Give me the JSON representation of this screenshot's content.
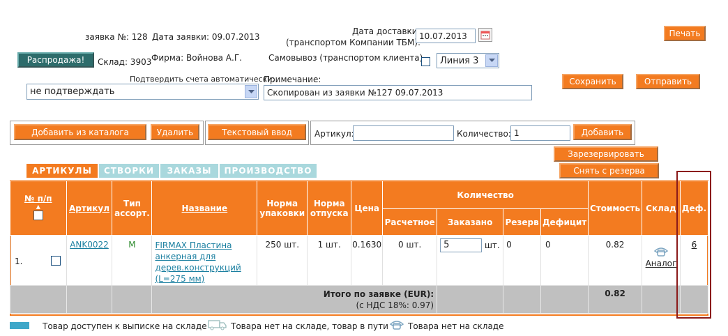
{
  "header": {
    "order_label": "заявка №: 128",
    "date_label": "Дата заявки:  09.07.2013",
    "delivery_label_1": "Дата доставки",
    "delivery_label_2": "(транспортом Компании ТБМ):",
    "delivery_date": "10.07.2013",
    "print_button": "Печать",
    "sale_button": "Распродажа!",
    "warehouse": "Склад: 3903",
    "firm": "Фирма: Войнова А.Г.",
    "pickup": "Самовывоз (транспортом клиента)",
    "line_select": "Линия 3",
    "auto_confirm_label": "Подтвердить счета автоматически:",
    "auto_confirm_value": "не подтверждать",
    "note_label": "Примечание:",
    "note_value": "Скопирован из заявки №127 09.07.2013",
    "save_button": "Сохранить",
    "send_button": "Отправить"
  },
  "toolbar": {
    "add_catalog": "Добавить из каталога",
    "delete": "Удалить",
    "text_input": "Текстовый ввод",
    "article_label": "Артикул:",
    "article_value": "",
    "quantity_label": "Количество:",
    "quantity_value": "1",
    "add": "Добавить",
    "reserve": "Зарезервировать",
    "unreserve": "Снять с резерва"
  },
  "tabs": [
    "АРТИКУЛЫ",
    "СТВОРКИ",
    "ЗАКАЗЫ",
    "ПРОИЗВОДСТВО"
  ],
  "table": {
    "h_num": "№ п/п",
    "h_article": "Артикул",
    "h_type": "Тип ассорт.",
    "h_name": "Название",
    "h_norm_pack": "Норма упаковки",
    "h_norm_release": "Норма отпуска",
    "h_price": "Цена",
    "h_quantity": "Количество",
    "h_calc": "Расчетное",
    "h_ordered": "Заказано",
    "h_reserve": "Резерв",
    "h_deficit": "Дефицит",
    "h_cost": "Стоимость",
    "h_stock": "Склад",
    "h_def": "Деф.",
    "row": {
      "num": "1.",
      "article": "ANK0022",
      "type": "M",
      "name": "FIRMAX Пластина анкерная для дерев.конструкций (L=275 мм)",
      "norm_pack": "250 шт.",
      "norm_release": "1 шт.",
      "price": "0.1630",
      "calc": "0 шт.",
      "ordered": "5",
      "ordered_unit": "шт.",
      "reserve": "0",
      "deficit": "0",
      "cost": "0.82",
      "analog": "Аналог",
      "def": "6"
    },
    "total_label": "Итого по заявке (EUR):",
    "total_vat": "(с НДС 18%: 0.97)",
    "total_value": "0.82"
  },
  "legend": {
    "available": "Товар доступен к выписке на складе",
    "in_transit": "Товара нет на складе, товар в пути",
    "not_available": "Товара нет на складе"
  },
  "colors": {
    "accent": "#f37b20",
    "tab_inactive": "#a9d8dd",
    "highlight_box": "#8b1a1a",
    "link": "#1a7fa0"
  }
}
